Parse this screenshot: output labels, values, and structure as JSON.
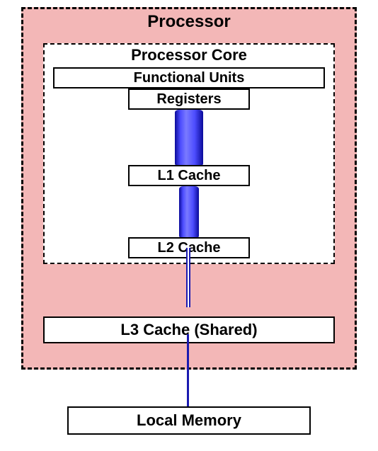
{
  "processor": {
    "title": "Processor",
    "core": {
      "title": "Processor Core",
      "functional_units": "Functional Units",
      "registers": "Registers",
      "l1": "L1 Cache",
      "l2": "L2 Cache"
    },
    "l3": "L3 Cache (Shared)"
  },
  "local_memory": "Local Memory"
}
